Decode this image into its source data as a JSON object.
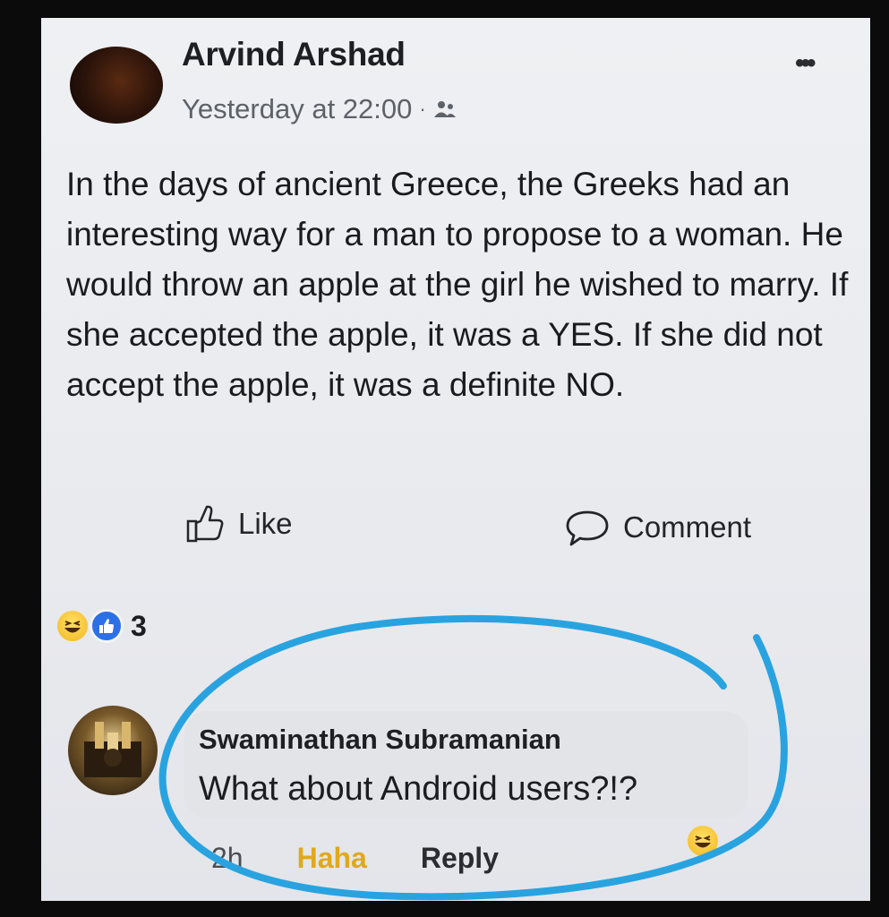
{
  "post": {
    "author": "Arvind Arshad",
    "timestamp": "Yesterday at 22:00",
    "separator": "·",
    "audience_icon": "friends-icon",
    "more_label": "•••",
    "text": "In the days of ancient Greece, the Greeks had an interesting way for a man to propose to a woman. He would throw an apple at the girl he wished to marry. If she accepted the apple, it was a YES. If she did not accept the apple, it was a definite NO."
  },
  "actions": {
    "like_label": "Like",
    "comment_label": "Comment"
  },
  "reactions": {
    "icons": [
      "haha-icon",
      "like-reaction-icon"
    ],
    "count": "3"
  },
  "comment": {
    "author": "Swaminathan Subramanian",
    "text": "What about Android users?!?",
    "time": "2h",
    "haha_label": "Haha",
    "reply_label": "Reply"
  },
  "colors": {
    "background": "#0b0b0b",
    "card": "#ecedf0",
    "circle_annotation": "#29a3e0",
    "like_blue": "#2d6fe6",
    "haha_gold": "#e0a91c"
  }
}
